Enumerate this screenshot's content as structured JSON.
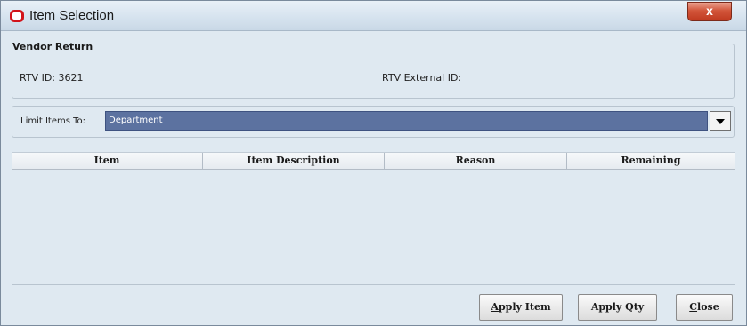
{
  "window": {
    "title": "Item Selection",
    "close_glyph": "x"
  },
  "vendor_return": {
    "legend": "Vendor Return",
    "rtv_id": "RTV ID: 3621",
    "rtv_external_id": "RTV External ID:"
  },
  "limit": {
    "label": "Limit Items To:",
    "selected": "Department"
  },
  "table": {
    "columns": [
      "Item",
      "Item Description",
      "Reason",
      "Remaining"
    ]
  },
  "buttons": {
    "apply_item": {
      "mnemonic": "A",
      "rest": "pply Item"
    },
    "apply_qty": {
      "label": "Apply Qty"
    },
    "close": {
      "mnemonic": "C",
      "rest": "lose"
    }
  },
  "colors": {
    "selection": "#5c72a0",
    "background": "#dfe9f1",
    "close_button": "#c03a20",
    "app_icon": "#d2131a"
  }
}
